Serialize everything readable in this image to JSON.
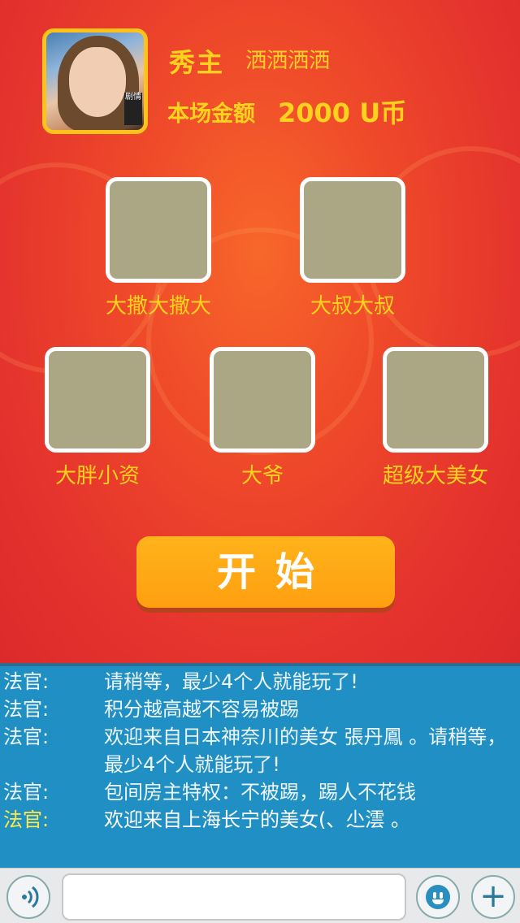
{
  "host": {
    "role": "秀主",
    "name": "洒洒洒洒",
    "amount_label": "本场金额",
    "amount_value": "2000 U币",
    "avatar_badge": "剧情"
  },
  "seats": [
    {
      "label": "大撒大撒大"
    },
    {
      "label": "大叔大叔"
    },
    {
      "label": "大胖小资"
    },
    {
      "label": "大爷"
    },
    {
      "label": "超级大美女"
    }
  ],
  "start_button": {
    "label": "开始"
  },
  "chat": {
    "messages": [
      {
        "sender": "法官:",
        "text": "请稍等，最少4个人就能玩了!",
        "highlight": false
      },
      {
        "sender": "法官:",
        "text": "积分越高越不容易被踢",
        "highlight": false
      },
      {
        "sender": "法官:",
        "text": "欢迎来自日本神奈川的美女 張丹鳳 。请稍等，最少4个人就能玩了!",
        "highlight": false
      },
      {
        "sender": "法官:",
        "text": "包间房主特权：不被踢，踢人不花钱",
        "highlight": false
      },
      {
        "sender": "法官:",
        "text": "欢迎来自上海长宁的美女(、尐澐 。",
        "highlight": true
      }
    ]
  },
  "input_bar": {
    "voice_icon": "voice-icon",
    "emoji_icon": "emoji-icon",
    "plus_icon": "plus-icon",
    "input_placeholder": ""
  },
  "colors": {
    "background_red": "#e5342d",
    "gold_text": "#ffd21e",
    "seat_fill": "#aba784",
    "start_orange": "#ff9f10",
    "chat_blue": "#1f8fc4"
  }
}
